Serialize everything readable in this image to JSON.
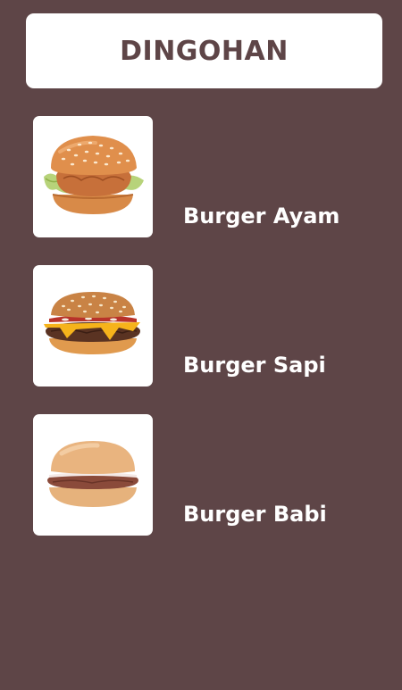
{
  "header": {
    "title": "DINGOHAN"
  },
  "menu": {
    "items": [
      {
        "label": "Burger Ayam",
        "image": "chicken-burger-image"
      },
      {
        "label": "Burger Sapi",
        "image": "beef-burger-image"
      },
      {
        "label": "Burger Babi",
        "image": "pork-burger-image"
      }
    ]
  },
  "colors": {
    "background": "#5e4547",
    "card": "#ffffff",
    "title_text": "#5e4547",
    "label_text": "#ffffff"
  }
}
